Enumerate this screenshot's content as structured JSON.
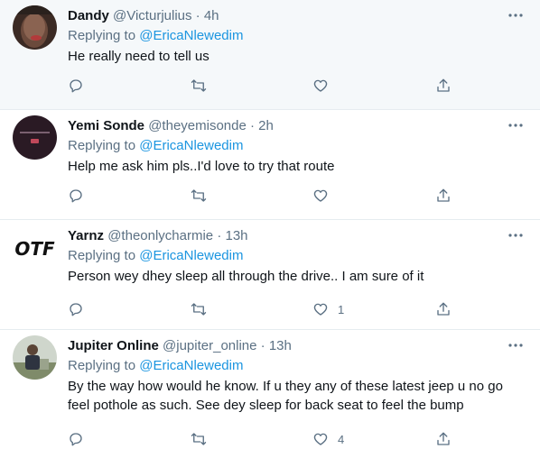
{
  "reply_prefix": "Replying to",
  "tweets": [
    {
      "name": "Dandy",
      "handle": "@Victurjulius",
      "dot": "·",
      "time": "4h",
      "mention": "@EricaNlewedim",
      "text": "He really need to tell us",
      "like_count": ""
    },
    {
      "name": "Yemi Sonde",
      "handle": "@theyemisonde",
      "dot": "·",
      "time": "2h",
      "mention": "@EricaNlewedim",
      "text": "Help me ask him pls..I'd love to try that route",
      "like_count": ""
    },
    {
      "name": "Yarnz",
      "handle": "@theonlycharmie",
      "dot": "·",
      "time": "13h",
      "mention": "@EricaNlewedim",
      "text": "Person wey dhey sleep all through the drive.. I am sure of it",
      "like_count": "1",
      "avatar_text": "OTF"
    },
    {
      "name": "Jupiter Online",
      "handle": "@jupiter_online",
      "dot": "·",
      "time": "13h",
      "mention": "@EricaNlewedim",
      "text": "By the way how would he know. If u they any of these latest jeep u no go feel pothole as such. See dey sleep for back seat to feel the bump",
      "like_count": "4"
    }
  ],
  "icons": {
    "reply": "reply-icon",
    "retweet": "retweet-icon",
    "like": "like-icon",
    "share": "share-icon",
    "more": "more-icon"
  },
  "colors": {
    "muted": "#5b7083",
    "link": "#1b95e0",
    "highlight_bg": "#f5f8fa",
    "divider": "#e6ecf0"
  }
}
